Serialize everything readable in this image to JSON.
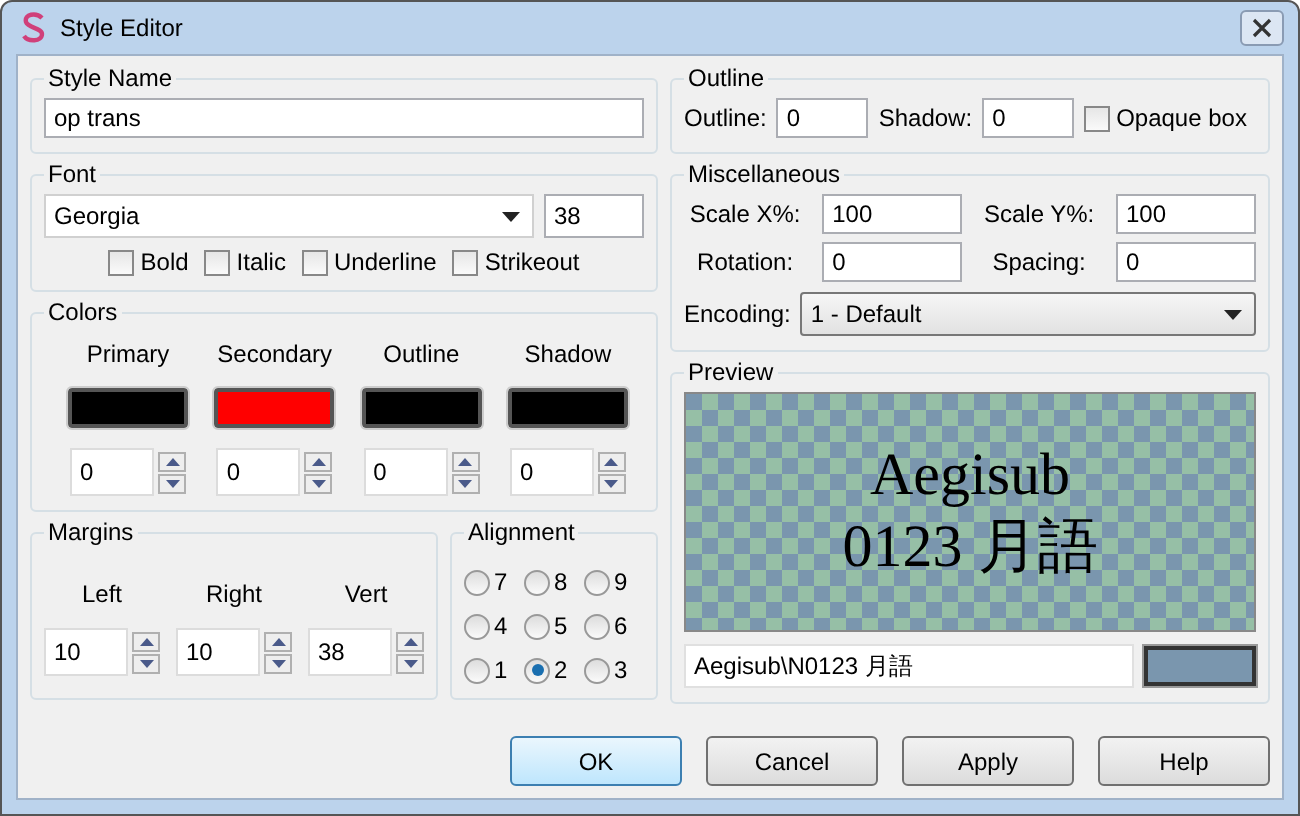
{
  "window": {
    "title": "Style Editor"
  },
  "style_name": {
    "label": "Style Name",
    "value": "op trans"
  },
  "font": {
    "label": "Font",
    "family": "Georgia",
    "size": "38",
    "options": [
      {
        "label": "Bold",
        "checked": false
      },
      {
        "label": "Italic",
        "checked": false
      },
      {
        "label": "Underline",
        "checked": false
      },
      {
        "label": "Strikeout",
        "checked": false
      }
    ]
  },
  "colors": {
    "label": "Colors",
    "items": [
      {
        "label": "Primary",
        "color": "#000000",
        "alpha": "0"
      },
      {
        "label": "Secondary",
        "color": "#ff0000",
        "alpha": "0"
      },
      {
        "label": "Outline",
        "color": "#000000",
        "alpha": "0"
      },
      {
        "label": "Shadow",
        "color": "#000000",
        "alpha": "0"
      }
    ]
  },
  "margins": {
    "label": "Margins",
    "items": [
      {
        "label": "Left",
        "value": "10"
      },
      {
        "label": "Right",
        "value": "10"
      },
      {
        "label": "Vert",
        "value": "38"
      }
    ]
  },
  "alignment": {
    "label": "Alignment",
    "options": [
      {
        "label": "7",
        "selected": false
      },
      {
        "label": "8",
        "selected": false
      },
      {
        "label": "9",
        "selected": false
      },
      {
        "label": "4",
        "selected": false
      },
      {
        "label": "5",
        "selected": false
      },
      {
        "label": "6",
        "selected": false
      },
      {
        "label": "1",
        "selected": false
      },
      {
        "label": "2",
        "selected": true
      },
      {
        "label": "3",
        "selected": false
      }
    ]
  },
  "outline": {
    "label": "Outline",
    "fields": [
      {
        "label": "Outline:",
        "value": "0"
      },
      {
        "label": "Shadow:",
        "value": "0"
      }
    ],
    "opaque_box": {
      "label": "Opaque box",
      "checked": false
    }
  },
  "misc": {
    "label": "Miscellaneous",
    "fields": [
      {
        "label": "Scale X%:",
        "value": "100"
      },
      {
        "label": "Scale Y%:",
        "value": "100"
      },
      {
        "label": "Rotation:",
        "value": "0"
      },
      {
        "label": "Spacing:",
        "value": "0"
      }
    ],
    "encoding": {
      "label": "Encoding:",
      "value": "1 - Default"
    }
  },
  "preview": {
    "label": "Preview",
    "lines": [
      "Aegisub",
      "0123 月語"
    ],
    "text": "Aegisub\\N0123 月語",
    "color": "#7a96ae"
  },
  "buttons": [
    {
      "label": "OK",
      "default": true
    },
    {
      "label": "Cancel",
      "default": false
    },
    {
      "label": "Apply",
      "default": false
    },
    {
      "label": "Help",
      "default": false
    }
  ]
}
